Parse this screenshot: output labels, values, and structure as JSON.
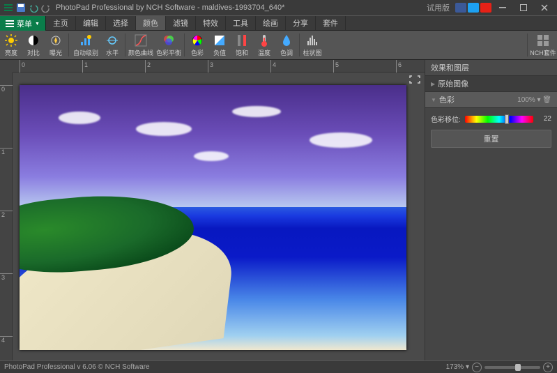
{
  "app": {
    "title": "PhotoPad Professional by NCH Software - maldives-1993704_640*",
    "trial_label": "试用版"
  },
  "menu": {
    "chip": "菜单",
    "items": [
      "主页",
      "编辑",
      "选择",
      "颜色",
      "滤镜",
      "特效",
      "工具",
      "绘画",
      "分享",
      "套件"
    ],
    "active_index": 3,
    "suite": "NCH套件"
  },
  "ribbon": {
    "tools": [
      {
        "id": "brightness",
        "label": "亮度"
      },
      {
        "id": "contrast",
        "label": "对比"
      },
      {
        "id": "exposure",
        "label": "曝光"
      },
      {
        "id": "autolevel",
        "label": "自动级别"
      },
      {
        "id": "levels",
        "label": "水平"
      },
      {
        "id": "curves",
        "label": "颜色曲线"
      },
      {
        "id": "colorbalance",
        "label": "色彩平衡"
      },
      {
        "id": "color",
        "label": "色彩"
      },
      {
        "id": "negative",
        "label": "负值"
      },
      {
        "id": "saturation",
        "label": "饱和"
      },
      {
        "id": "temperature",
        "label": "温度"
      },
      {
        "id": "hue",
        "label": "色调"
      },
      {
        "id": "histogram",
        "label": "柱状图"
      }
    ],
    "suite_label": "NCH套件"
  },
  "ruler": {
    "h": [
      "0",
      "1",
      "2",
      "3",
      "4",
      "5",
      "6"
    ],
    "v": [
      "0",
      "1",
      "2",
      "3",
      "4"
    ]
  },
  "panel": {
    "header": "效果和图层",
    "original": "原始图像",
    "adjustment": {
      "name": "色彩",
      "opacity": "100%"
    },
    "slider": {
      "label": "色彩移位:",
      "value": "22"
    },
    "reset": "重置"
  },
  "status": {
    "text": "PhotoPad Professional v 6.06 © NCH Software",
    "zoom": "173%"
  }
}
